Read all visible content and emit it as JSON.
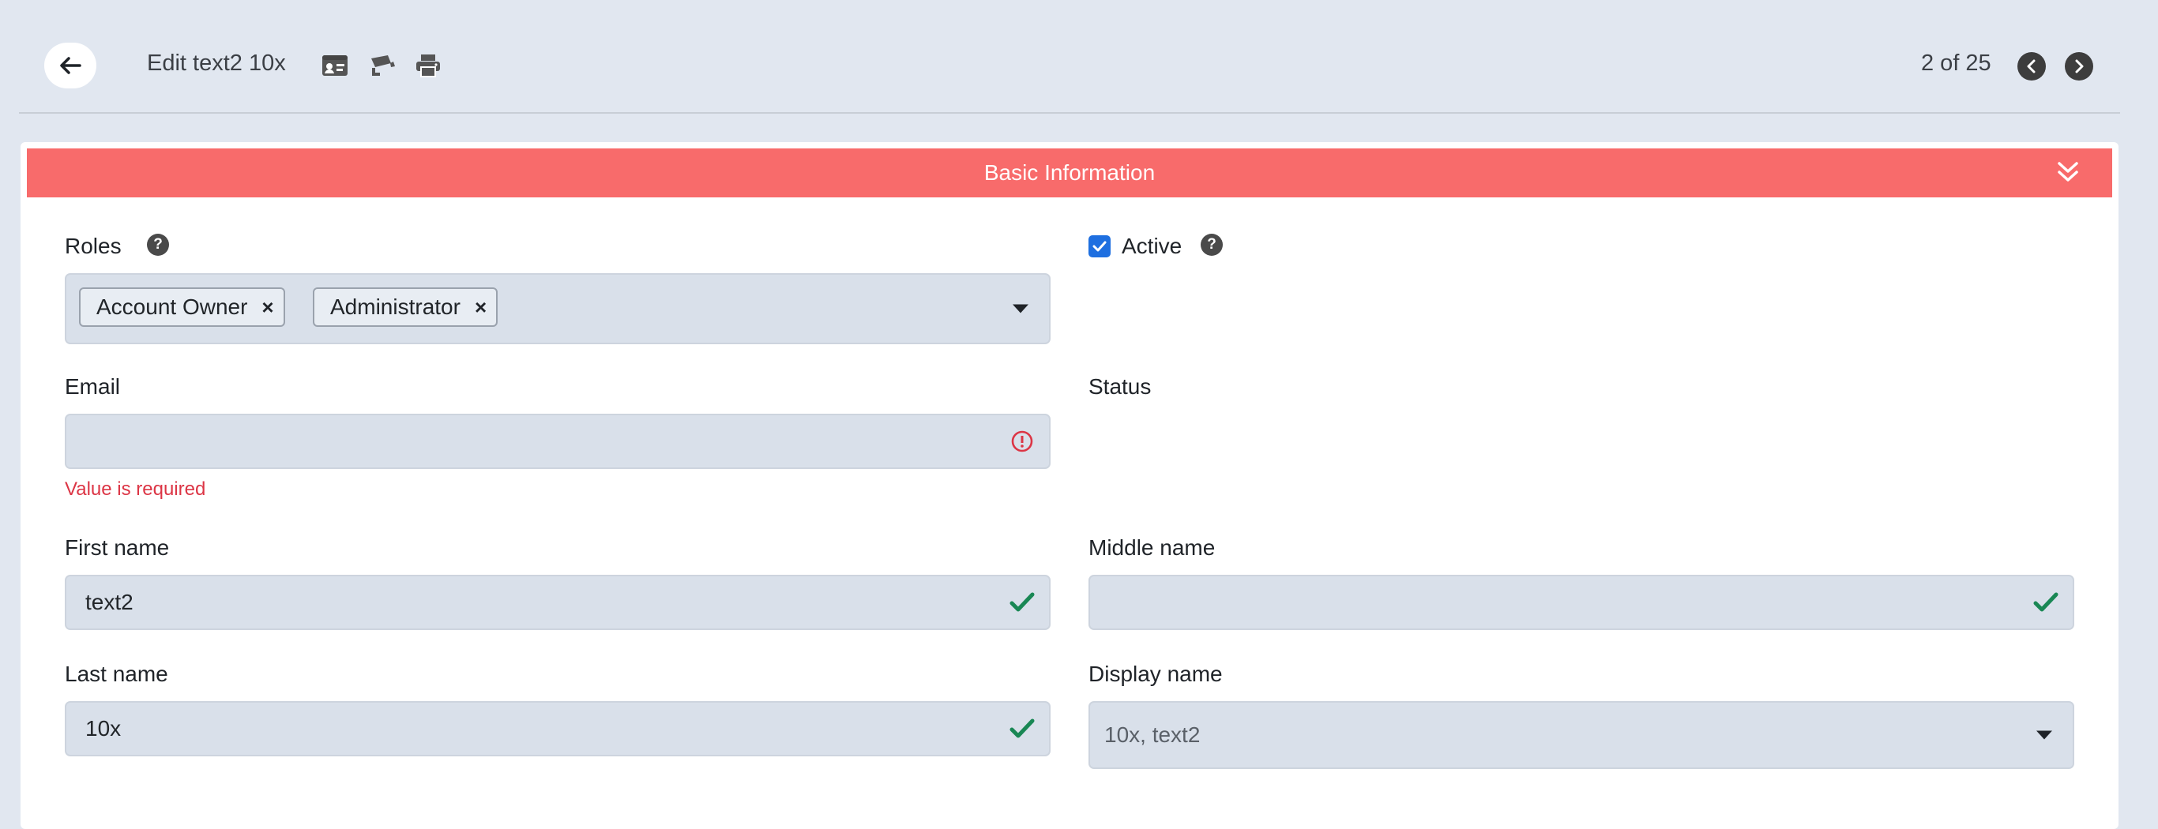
{
  "header": {
    "back_icon": "arrow-left-icon",
    "title": "Edit text2 10x",
    "tools": [
      "id-card-icon",
      "video-camera-icon",
      "print-icon"
    ],
    "pager_text": "2 of 25"
  },
  "section": {
    "title": "Basic Information",
    "collapse_icon": "double-chevron-down-icon",
    "header_color": "#f86b6b"
  },
  "form": {
    "roles": {
      "label": "Roles",
      "tags": [
        "Account Owner",
        "Administrator"
      ]
    },
    "active": {
      "label": "Active",
      "checked": true
    },
    "email": {
      "label": "Email",
      "value": "",
      "error": "Value is required"
    },
    "status": {
      "label": "Status"
    },
    "first_name": {
      "label": "First name",
      "value": "text2"
    },
    "middle_name": {
      "label": "Middle name",
      "value": ""
    },
    "last_name": {
      "label": "Last name",
      "value": "10x"
    },
    "display_name": {
      "label": "Display name",
      "value": "10x, text2"
    }
  },
  "colors": {
    "background": "#e1e7f0",
    "field_bg": "#d9e0ea",
    "error": "#dc3545",
    "success": "#198754",
    "checkbox": "#1e6fe0"
  }
}
